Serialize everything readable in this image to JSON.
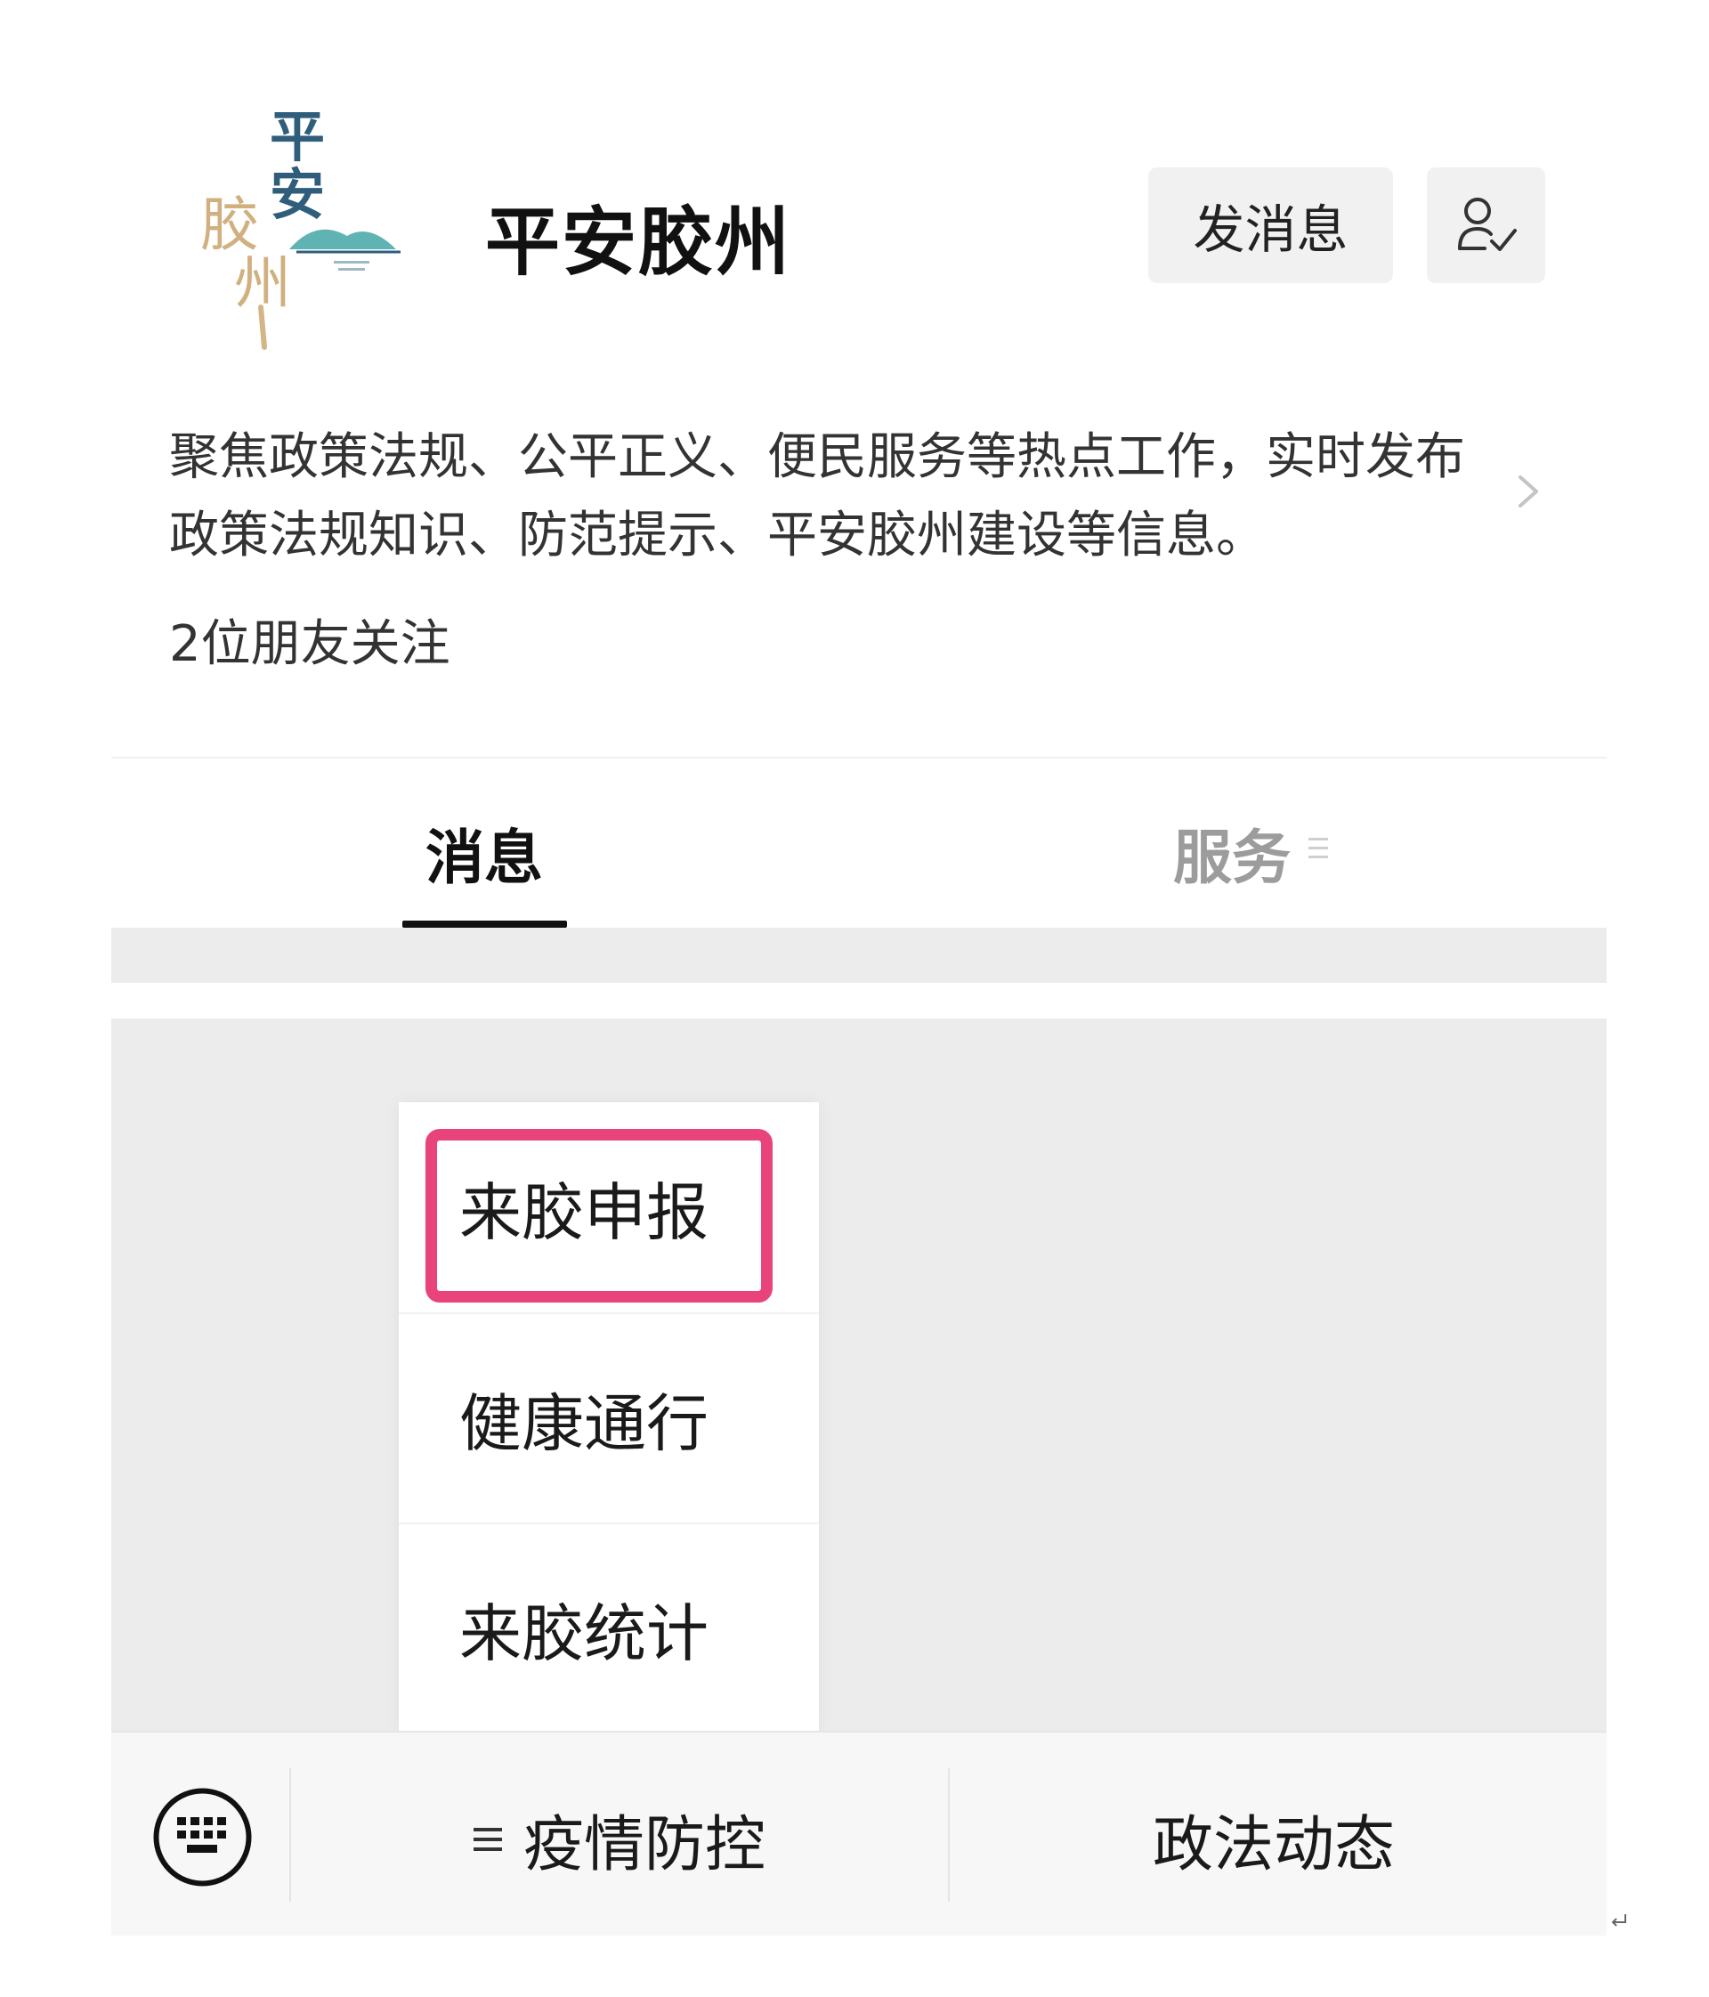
{
  "profile": {
    "name": "平安胶州",
    "logo_text": "平安胶州",
    "send_message_label": "发消息",
    "follow_icon": "person-check-icon",
    "description": "聚焦政策法规、公平正义、便民服务等热点工作，实时发布政策法规知识、防范提示、平安胶州建设等信息。",
    "followers": "2位朋友关注"
  },
  "tabs": [
    {
      "label": "消息",
      "active": true
    },
    {
      "label": "服务",
      "active": false
    }
  ],
  "popup_menu": {
    "items": [
      "来胶申报",
      "健康通行",
      "来胶统计"
    ],
    "highlighted_index": 0
  },
  "bottom_menu": {
    "keyboard_icon": "keyboard-icon",
    "items": [
      {
        "label": "疫情防控",
        "has_submenu": true
      },
      {
        "label": "政法动态",
        "has_submenu": false
      }
    ]
  },
  "colors": {
    "highlight": "#e8437a",
    "logo_blue": "#2f5d7c",
    "logo_gold": "#c9a36a",
    "logo_teal": "#5fb3b3",
    "inactive_tab": "#9c9c9c"
  }
}
